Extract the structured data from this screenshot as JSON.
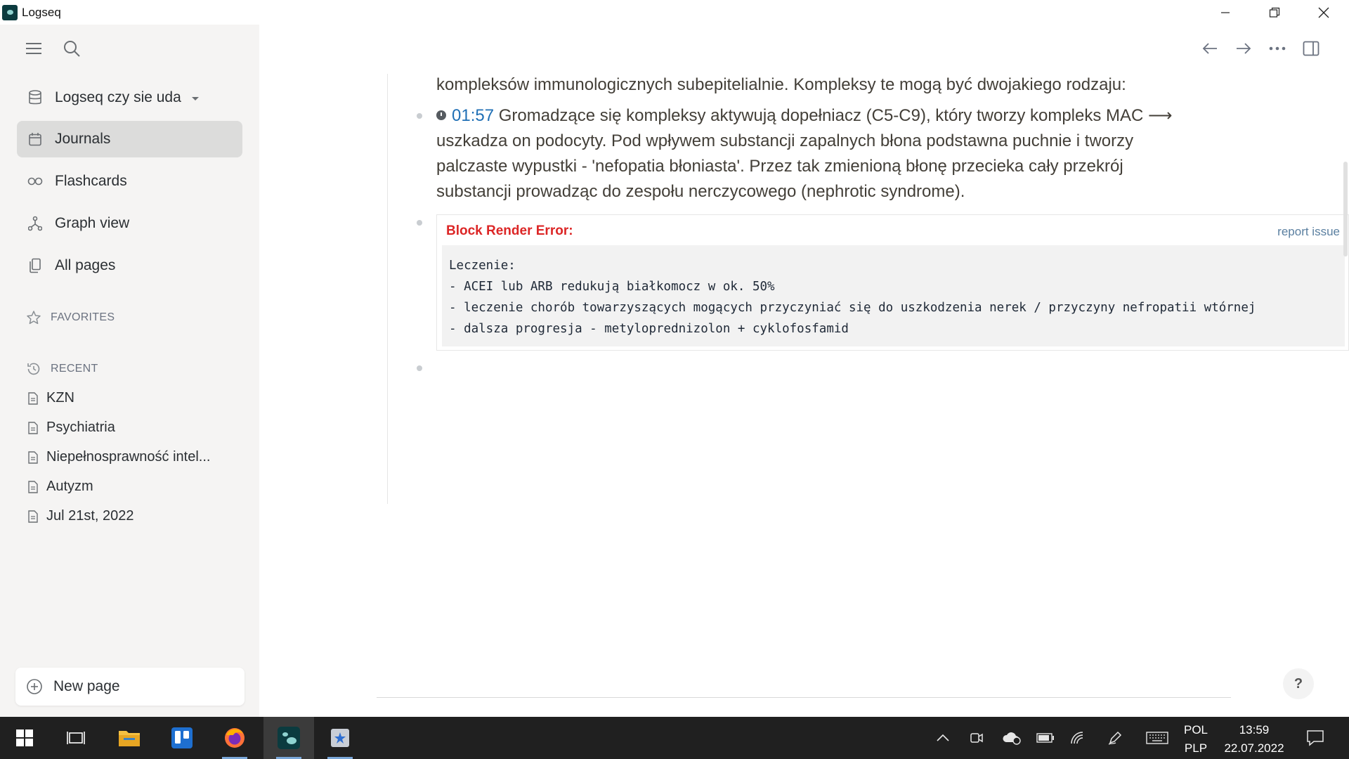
{
  "window": {
    "title": "Logseq"
  },
  "sidebar": {
    "graph_name": "Logseq czy sie uda",
    "nav": [
      {
        "label": "Journals"
      },
      {
        "label": "Flashcards"
      },
      {
        "label": "Graph view"
      },
      {
        "label": "All pages"
      }
    ],
    "favorites_label": "FAVORITES",
    "recent_label": "RECENT",
    "recent": [
      "KZN",
      "Psychiatria",
      "Niepełnosprawność intel...",
      "Autyzm",
      "Jul 21st, 2022"
    ],
    "new_page_label": "New page"
  },
  "content": {
    "line1": "kompleksów immunologicznych subepitelialnie. Kompleksy te mogą być dwojakiego rodzaju:",
    "block2": {
      "timestamp": "01:57",
      "line1": "Gromadzące się kompleksy aktywują dopełniacz (C5-C9), który tworzy kompleks MAC ⟶",
      "line2": "uszkadza on podocyty. Pod wpływem substancji zapalnych błona podstawna puchnie i tworzy",
      "line3": "palczaste wypustki - 'nefopatia błoniasta'. Przez tak zmienioną błonę przecieka cały przekrój",
      "line4": "substancji prowadząc do zespołu nerczycowego (nephrotic syndrome)."
    },
    "error": {
      "title": "Block Render Error:",
      "report_label": "report issue",
      "code_lines": [
        "Leczenie:",
        "- ACEI lub ARB redukują białkomocz w ok. 50%",
        "- leczenie chorób towarzyszących mogących przyczyniać się do uszkodzenia nerek / przyczyny nefropatii wtórnej",
        "- dalsza progresja - metyloprednizolon + cyklofosfamid"
      ]
    },
    "help_label": "?"
  },
  "taskbar": {
    "lang1": "POL",
    "lang2": "PLP",
    "time": "13:59",
    "date": "22.07.2022"
  }
}
